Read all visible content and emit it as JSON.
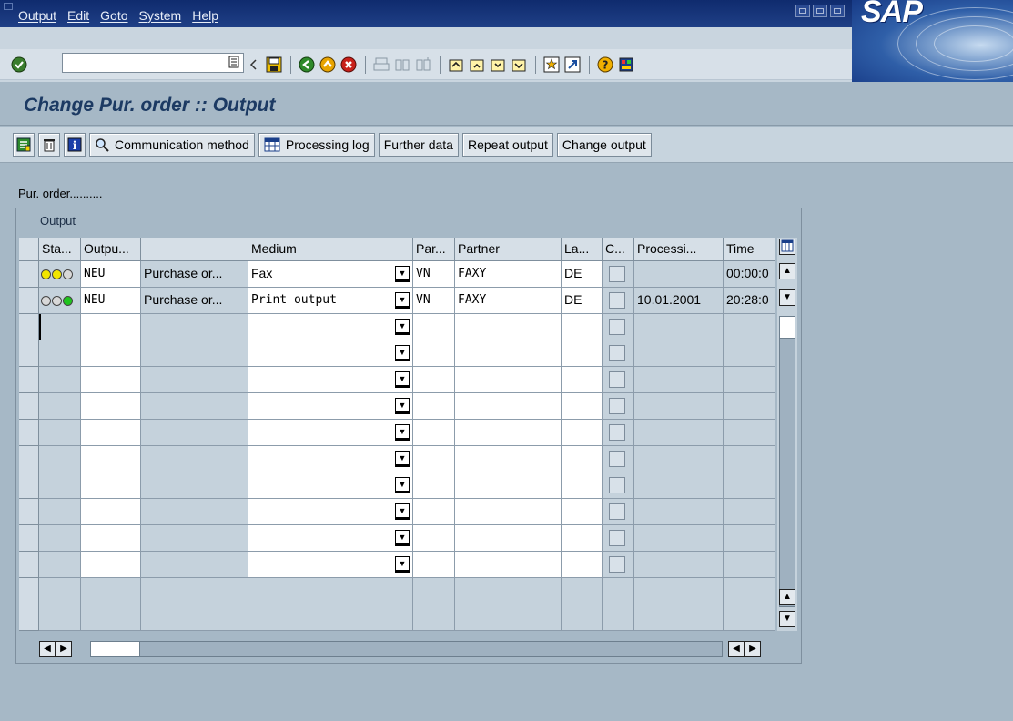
{
  "menu": {
    "items": [
      "Output",
      "Edit",
      "Goto",
      "System",
      "Help"
    ]
  },
  "logo": {
    "text": "SAP"
  },
  "command_field": {
    "value": ""
  },
  "title": {
    "text": "Change Pur. order :: Output"
  },
  "app_toolbar": {
    "communication_method": "Communication method",
    "processing_log": "Processing log",
    "further_data": "Further data",
    "repeat_output": "Repeat output",
    "change_output": "Change output"
  },
  "content": {
    "pur_order_label": "Pur. order..........",
    "panel_caption": "Output"
  },
  "table": {
    "headers": [
      "Sta...",
      "Outpu...",
      "",
      "Medium",
      "Par...",
      "Partner",
      "La...",
      "C...",
      "Processi...",
      "Time"
    ],
    "rows": [
      {
        "status": [
          "yellow",
          "yellow",
          "yellow"
        ],
        "output": "NEU",
        "desc": "Purchase or...",
        "medium": "Fax",
        "partner_func": "VN",
        "partner": "FAXY",
        "lang": "DE",
        "processed": "",
        "time": "00:00:0"
      },
      {
        "status": [
          "green",
          "green",
          "green"
        ],
        "output": "NEU",
        "desc": "Purchase or...",
        "medium": "Print output",
        "partner_func": "VN",
        "partner": "FAXY",
        "lang": "DE",
        "processed": "10.01.2001",
        "time": "20:28:0"
      }
    ],
    "empty_input_rows": 10,
    "empty_ro_rows": 2
  },
  "colors": {
    "menubar": "#0f2b6e",
    "background": "#a6b8c6",
    "title_text": "#1c3a63",
    "light_yellow": "#f2e600",
    "light_green": "#1fc41f"
  }
}
